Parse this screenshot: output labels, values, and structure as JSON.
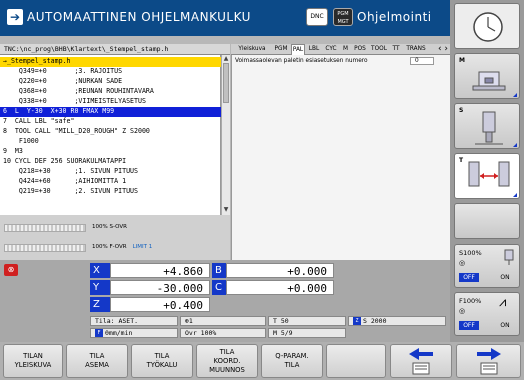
{
  "header": {
    "mode_title": "AUTOMAATTINEN OHJELMANKULKU",
    "dnc_label": "DNC",
    "pgm_mgt_label": "PGM\nMGT",
    "edit_title": "Ohjelmointi"
  },
  "program": {
    "path": "TNC:\\nc_prog\\BHB\\Klartext\\_Stempel_stamp.h",
    "lines": [
      {
        "text": "→_Stempel_stamp.h",
        "style": "sel-y"
      },
      {
        "text": "    Q349=+0       ;3. RAJOITUS"
      },
      {
        "text": "    Q220=+0       ;NURKAN SADE"
      },
      {
        "text": "    Q368=+0       ;REUNAN ROUHINTAVARA"
      },
      {
        "text": "    Q338=+0       ;VIIMEISTELYASETUS"
      },
      {
        "text": "6  L  Y-30  X+30 R0 FMAX M99",
        "style": "sel-b"
      },
      {
        "text": "7  CALL LBL \"safe\""
      },
      {
        "text": "8  TOOL CALL \"MILL_D20_ROUGH\" Z S2000"
      },
      {
        "text": "    F1000"
      },
      {
        "text": "9  M3"
      },
      {
        "text": "10 CYCL DEF 256 SUORAKULMATAPPI"
      },
      {
        "text": "    Q218=+30      ;1. SIVUN PITUUS"
      },
      {
        "text": "    Q424=+60      ;AIHIOMITTA 1"
      },
      {
        "text": "    Q219=+30      ;2. SIVUN PITUUS"
      }
    ]
  },
  "tabs": {
    "items": [
      "Yleiskuva",
      "PGM",
      "PAL",
      "LBL",
      "CYC",
      "M",
      "POS",
      "TOOL",
      "TT",
      "TRANS"
    ],
    "active": "PAL",
    "nav": "‹ ›"
  },
  "info": {
    "row_label": "Voimassaolevan paletin esiasetuksen numero",
    "row_value": "0"
  },
  "overrides": {
    "spindle": "100% S-OVR",
    "feed": "100% F-OVR",
    "limit": "LIMIT 1"
  },
  "positions": {
    "X": "+4.860",
    "Y": "-30.000",
    "Z": "+0.400",
    "B": "+0.000",
    "C": "+0.000"
  },
  "status": {
    "tila": "Tila: ASET.",
    "tool_num": "1",
    "t_field": "T 50",
    "z_s": "S 2000",
    "feed": "0mm/min",
    "ovr": "Ovr 100%",
    "m_field": "M 5/9"
  },
  "softkeys": [
    "TILAN\nYLEISKUVA",
    "TILA\nASEMA",
    "TILA\nTYÖKALU",
    "TILA\nKOORD.\nMUUNNOS",
    "Q-PARAM.\nTILA",
    "",
    "",
    ""
  ],
  "right_panel": {
    "s_pct": "S100%",
    "f_pct": "F100%",
    "off": "OFF",
    "on": "ON"
  }
}
